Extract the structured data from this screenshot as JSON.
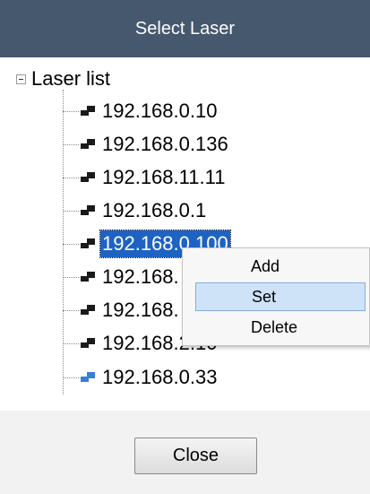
{
  "window": {
    "title": "Select Laser"
  },
  "tree": {
    "root_label": "Laser list",
    "nodes": [
      {
        "label": "192.168.0.10",
        "icon": "network-device-icon"
      },
      {
        "label": "192.168.0.136",
        "icon": "network-device-icon"
      },
      {
        "label": "192.168.11.11",
        "icon": "network-device-icon"
      },
      {
        "label": "192.168.0.1",
        "icon": "network-device-icon"
      },
      {
        "label": "192.168.0.100",
        "icon": "network-device-icon",
        "selected": true
      },
      {
        "label": "192.168.",
        "icon": "network-device-icon"
      },
      {
        "label": "192.168.",
        "icon": "network-device-icon"
      },
      {
        "label": "192.168.2.10",
        "icon": "network-device-icon"
      },
      {
        "label": "192.168.0.33",
        "icon": "network-device-blue-icon"
      }
    ]
  },
  "context_menu": {
    "items": [
      {
        "label": "Add"
      },
      {
        "label": "Set",
        "highlighted": true
      },
      {
        "label": "Delete"
      }
    ]
  },
  "footer": {
    "close_label": "Close"
  },
  "colors": {
    "titlebar": "#46586e",
    "selection": "#1e63c4",
    "menu_hover": "#cfe3f8",
    "active_icon": "#3a7fd6"
  }
}
